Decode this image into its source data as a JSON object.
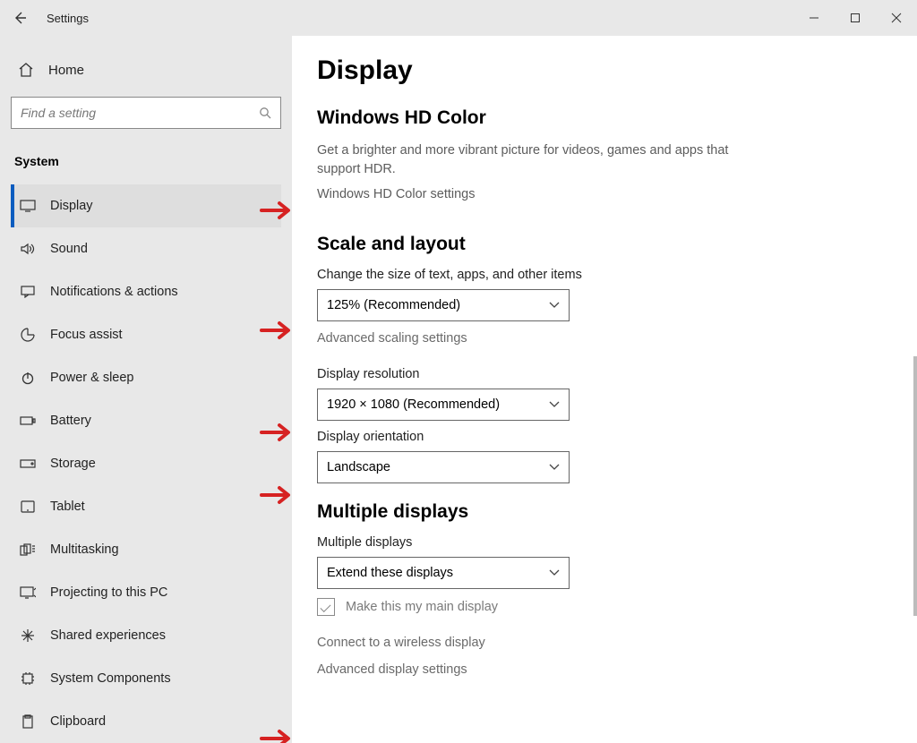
{
  "window": {
    "title": "Settings"
  },
  "sidebar": {
    "home_label": "Home",
    "search_placeholder": "Find a setting",
    "category": "System",
    "items": [
      {
        "label": "Display",
        "icon": "display-icon",
        "active": true
      },
      {
        "label": "Sound",
        "icon": "sound-icon"
      },
      {
        "label": "Notifications & actions",
        "icon": "notifications-icon"
      },
      {
        "label": "Focus assist",
        "icon": "focus-assist-icon"
      },
      {
        "label": "Power & sleep",
        "icon": "power-icon"
      },
      {
        "label": "Battery",
        "icon": "battery-icon"
      },
      {
        "label": "Storage",
        "icon": "storage-icon"
      },
      {
        "label": "Tablet",
        "icon": "tablet-icon"
      },
      {
        "label": "Multitasking",
        "icon": "multitasking-icon"
      },
      {
        "label": "Projecting to this PC",
        "icon": "projecting-icon"
      },
      {
        "label": "Shared experiences",
        "icon": "shared-icon"
      },
      {
        "label": "System Components",
        "icon": "components-icon"
      },
      {
        "label": "Clipboard",
        "icon": "clipboard-icon"
      }
    ]
  },
  "main": {
    "title": "Display",
    "hd": {
      "heading": "Windows HD Color",
      "desc": "Get a brighter and more vibrant picture for videos, games and apps that support HDR.",
      "link": "Windows HD Color settings"
    },
    "scale": {
      "heading": "Scale and layout",
      "size_label": "Change the size of text, apps, and other items",
      "size_value": "125% (Recommended)",
      "advanced_scaling": "Advanced scaling settings",
      "res_label": "Display resolution",
      "res_value": "1920 × 1080 (Recommended)",
      "orient_label": "Display orientation",
      "orient_value": "Landscape"
    },
    "multi": {
      "heading": "Multiple displays",
      "dd_label": "Multiple displays",
      "dd_value": "Extend these displays",
      "main_check_label": "Make this my main display",
      "wireless_link": "Connect to a wireless display",
      "advanced_link": "Advanced display settings"
    }
  },
  "annotations": {
    "arrows": [
      {
        "target": "hd-color-link"
      },
      {
        "target": "text-size-dropdown"
      },
      {
        "target": "resolution-dropdown"
      },
      {
        "target": "orientation-dropdown"
      },
      {
        "target": "advanced-display-link"
      }
    ],
    "color": "#d62222"
  }
}
